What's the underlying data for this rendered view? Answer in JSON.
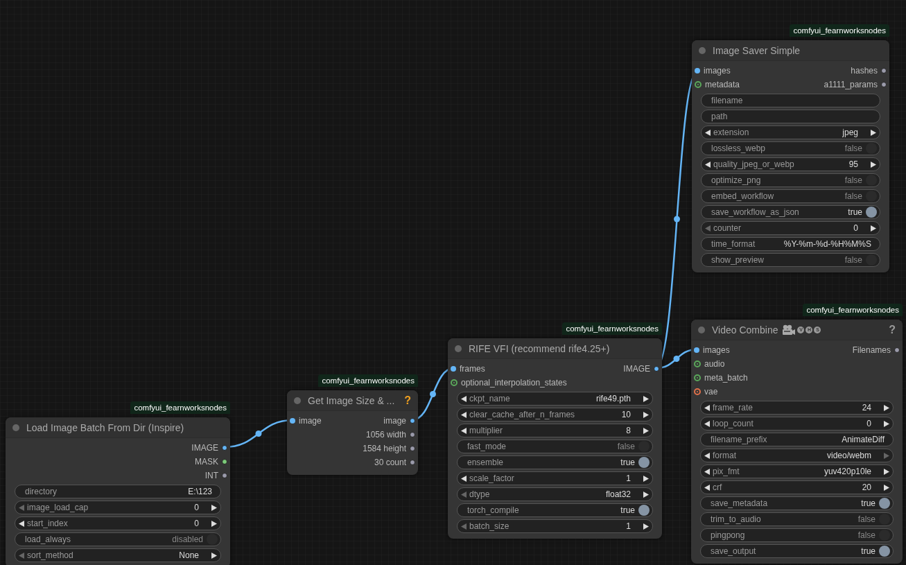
{
  "nodes": [
    {
      "badge": "comfyui_fearnworksnodes",
      "title": "Image Saver Simple",
      "inputs": [
        {
          "label": "images",
          "color": "#64b5f6",
          "optional": false
        },
        {
          "label": "metadata",
          "color": "#5aa85a",
          "optional": true
        }
      ],
      "outputs": [
        {
          "label": "hashes",
          "color": "#9a9aaa"
        },
        {
          "label": "a1111_params",
          "color": "#9a9aaa"
        }
      ],
      "widgets": [
        {
          "kind": "text",
          "label": "filename"
        },
        {
          "kind": "text",
          "label": "path"
        },
        {
          "kind": "combo",
          "label": "extension",
          "value": "jpeg",
          "left_disabled": false,
          "right_disabled": false
        },
        {
          "kind": "toggle",
          "label": "lossless_webp",
          "value": "false",
          "on": false
        },
        {
          "kind": "combo",
          "label": "quality_jpeg_or_webp",
          "value": "95",
          "left_disabled": false,
          "right_disabled": false
        },
        {
          "kind": "toggle",
          "label": "optimize_png",
          "value": "false",
          "on": false
        },
        {
          "kind": "toggle",
          "label": "embed_workflow",
          "value": "false",
          "on": false
        },
        {
          "kind": "toggle",
          "label": "save_workflow_as_json",
          "value": "true",
          "on": true
        },
        {
          "kind": "combo",
          "label": "counter",
          "value": "0",
          "left_disabled": true,
          "right_disabled": false
        },
        {
          "kind": "text",
          "label": "time_format",
          "value": "%Y-%m-%d-%H%M%S"
        },
        {
          "kind": "toggle",
          "label": "show_preview",
          "value": "false",
          "on": false
        }
      ]
    },
    {
      "badge": "comfyui_fearnworksnodes",
      "title": "Video Combine",
      "title_badges": [
        "V",
        "H",
        "S"
      ],
      "help": {
        "text": "?",
        "color": "#9a9a9a"
      },
      "inputs": [
        {
          "label": "images",
          "color": "#64b5f6",
          "optional": false
        },
        {
          "label": "audio",
          "color": "#5aa85a",
          "optional": true
        },
        {
          "label": "meta_batch",
          "color": "#5aa85a",
          "optional": true
        },
        {
          "label": "vae",
          "color": "#e0704a",
          "optional": true
        }
      ],
      "outputs": [
        {
          "label": "Filenames",
          "color": "#9a9aaa"
        }
      ],
      "widgets": [
        {
          "kind": "combo",
          "label": "frame_rate",
          "value": "24",
          "left_disabled": false,
          "right_disabled": false
        },
        {
          "kind": "combo",
          "label": "loop_count",
          "value": "0",
          "left_disabled": false,
          "right_disabled": false
        },
        {
          "kind": "text",
          "label": "filename_prefix",
          "value": "AnimateDiff"
        },
        {
          "kind": "combo",
          "label": "format",
          "value": "video/webm",
          "left_disabled": false,
          "right_disabled": true
        },
        {
          "kind": "combo",
          "label": "pix_fmt",
          "value": "yuv420p10le",
          "left_disabled": false,
          "right_disabled": false
        },
        {
          "kind": "combo",
          "label": "crf",
          "value": "20",
          "left_disabled": false,
          "right_disabled": false
        },
        {
          "kind": "toggle",
          "label": "save_metadata",
          "value": "true",
          "on": true
        },
        {
          "kind": "toggle",
          "label": "trim_to_audio",
          "value": "false",
          "on": false
        },
        {
          "kind": "toggle",
          "label": "pingpong",
          "value": "false",
          "on": false
        },
        {
          "kind": "toggle",
          "label": "save_output",
          "value": "true",
          "on": true
        }
      ]
    },
    {
      "badge": "comfyui_fearnworksnodes",
      "title": "RIFE VFI (recommend rife4.25+)",
      "inputs": [
        {
          "label": "frames",
          "color": "#64b5f6",
          "optional": false
        },
        {
          "label": "optional_interpolation_states",
          "color": "#5aa85a",
          "optional": true
        }
      ],
      "outputs": [
        {
          "label": "IMAGE",
          "color": "#64b5f6"
        }
      ],
      "widgets": [
        {
          "kind": "combo",
          "label": "ckpt_name",
          "value": "rife49.pth",
          "left_disabled": false,
          "right_disabled": false
        },
        {
          "kind": "combo",
          "label": "clear_cache_after_n_frames",
          "value": "10",
          "left_disabled": false,
          "right_disabled": false
        },
        {
          "kind": "combo",
          "label": "multiplier",
          "value": "8",
          "left_disabled": false,
          "right_disabled": false
        },
        {
          "kind": "toggle",
          "label": "fast_mode",
          "value": "false",
          "on": false
        },
        {
          "kind": "toggle",
          "label": "ensemble",
          "value": "true",
          "on": true
        },
        {
          "kind": "combo",
          "label": "scale_factor",
          "value": "1",
          "left_disabled": false,
          "right_disabled": false
        },
        {
          "kind": "combo",
          "label": "dtype",
          "value": "float32",
          "left_disabled": true,
          "right_disabled": false
        },
        {
          "kind": "toggle",
          "label": "torch_compile",
          "value": "true",
          "on": true
        },
        {
          "kind": "combo",
          "label": "batch_size",
          "value": "1",
          "left_disabled": true,
          "right_disabled": false
        }
      ]
    },
    {
      "badge": "comfyui_fearnworksnodes",
      "title": "Get Image Size & ...",
      "help": {
        "text": "?",
        "color": "#f0a020"
      },
      "inputs": [
        {
          "label": "image",
          "color": "#64b5f6",
          "optional": false
        }
      ],
      "outputs": [
        {
          "label": "image",
          "color": "#64b5f6"
        },
        {
          "label": "1056 width",
          "color": "#9a9aaa"
        },
        {
          "label": "1584 height",
          "color": "#9a9aaa"
        },
        {
          "label": "30 count",
          "color": "#9a9aaa"
        }
      ]
    },
    {
      "badge": "comfyui_fearnworksnodes",
      "title": "Load Image Batch From Dir (Inspire)",
      "outputs": [
        {
          "label": "IMAGE",
          "color": "#64b5f6"
        },
        {
          "label": "MASK",
          "color": "#7ccb7a"
        },
        {
          "label": "INT",
          "color": "#9a9aaa"
        }
      ],
      "widgets": [
        {
          "kind": "text",
          "label": "directory",
          "value": "E:\\123"
        },
        {
          "kind": "combo",
          "label": "image_load_cap",
          "value": "0",
          "left_disabled": true,
          "right_disabled": false
        },
        {
          "kind": "combo",
          "label": "start_index",
          "value": "0",
          "left_disabled": false,
          "right_disabled": false
        },
        {
          "kind": "toggle",
          "label": "load_always",
          "value": "disabled",
          "on": false
        },
        {
          "kind": "combo",
          "label": "sort_method",
          "value": "None",
          "left_disabled": true,
          "right_disabled": false
        }
      ]
    }
  ]
}
